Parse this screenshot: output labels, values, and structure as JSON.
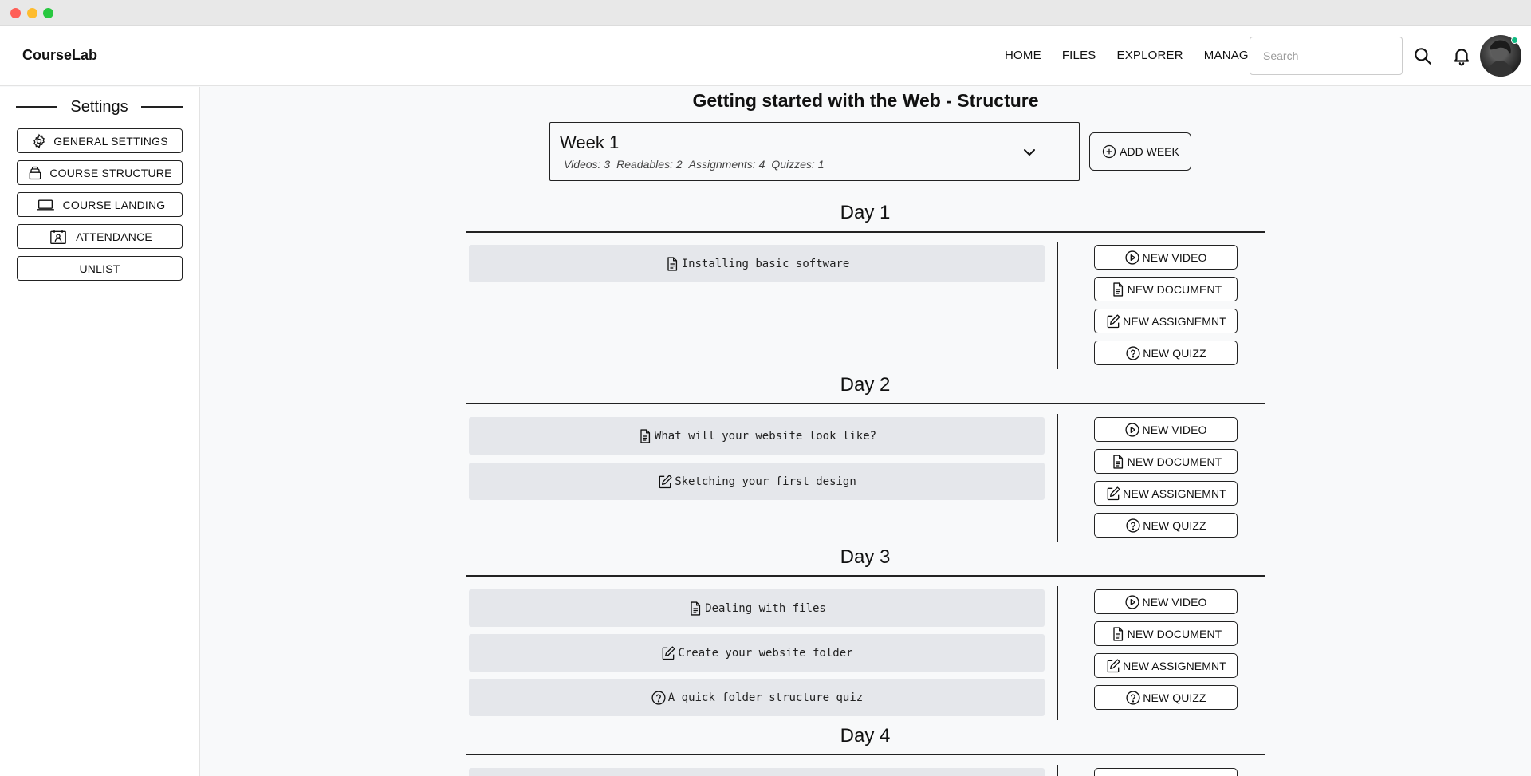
{
  "app": {
    "brand": "CourseLab"
  },
  "nav": {
    "links": [
      "HOME",
      "FILES",
      "EXPLORER",
      "MANAGER"
    ],
    "search_placeholder": "Search"
  },
  "sidebar": {
    "heading": "Settings",
    "items": [
      {
        "label": "GENERAL SETTINGS",
        "icon": "gear-icon"
      },
      {
        "label": "COURSE STRUCTURE",
        "icon": "stack-icon"
      },
      {
        "label": "COURSE LANDING",
        "icon": "laptop-icon"
      },
      {
        "label": "ATTENDANCE",
        "icon": "calendar-user-icon"
      },
      {
        "label": "UNLIST",
        "icon": ""
      }
    ]
  },
  "main": {
    "title": "Getting started with the Web - Structure",
    "week": {
      "title": "Week 1",
      "stats": [
        "Videos: 3",
        "Readables: 2",
        "Assignments: 4",
        "Quizzes: 1"
      ]
    },
    "add_week_label": "ADD WEEK",
    "actions": [
      "NEW VIDEO",
      "NEW DOCUMENT",
      "NEW ASSIGNEMNT",
      "NEW QUIZZ"
    ],
    "days": [
      {
        "title": "Day 1",
        "items": [
          {
            "label": "Installing basic software",
            "icon": "document-icon"
          }
        ]
      },
      {
        "title": "Day 2",
        "items": [
          {
            "label": "What will your website look like?",
            "icon": "document-icon"
          },
          {
            "label": "Sketching your first design",
            "icon": "edit-icon"
          }
        ]
      },
      {
        "title": "Day 3",
        "items": [
          {
            "label": "Dealing with files",
            "icon": "document-icon"
          },
          {
            "label": "Create your website folder",
            "icon": "edit-icon"
          },
          {
            "label": "A quick folder structure quiz",
            "icon": "question-icon"
          }
        ]
      },
      {
        "title": "Day 4",
        "items": []
      }
    ]
  },
  "colors": {
    "accent": "#222222",
    "item_bg": "#e5e7eb",
    "status_dot": "#10b981"
  }
}
